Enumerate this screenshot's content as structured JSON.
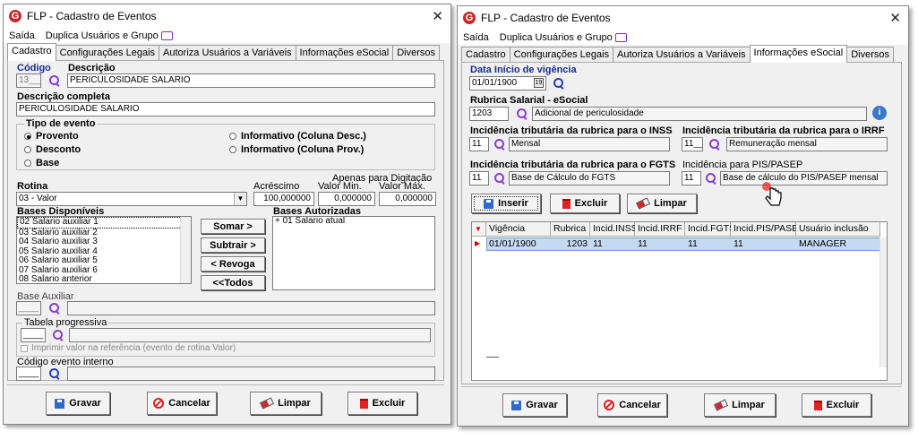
{
  "left": {
    "title": "FLP - Cadastro de Eventos",
    "menu": [
      "Saída",
      "Duplica Usuários e Grupo"
    ],
    "tabs": [
      "Cadastro",
      "Configurações Legais",
      "Autoriza Usuários a Variáveis",
      "Informações eSocial",
      "Diversos"
    ],
    "codigo_label": "Código",
    "codigo_value": "13___",
    "descricao_label": "Descrição",
    "descricao_value": "PERICULOSIDADE SALARIO",
    "desc_completa_label": "Descrição completa",
    "desc_completa_value": "PERICULOSIDADE SALARIO",
    "tipo_label": "Tipo de evento",
    "radios": [
      "Provento",
      "Desconto",
      "Base",
      "Informativo (Coluna Desc.)",
      "Informativo (Coluna Prov.)"
    ],
    "rotina_label": "Rotina",
    "rotina_value": "03 - Valor",
    "acrescimo_label": "Acréscimo",
    "acrescimo_value": "100,000000",
    "digitacao_label": "Apenas para Digitação",
    "valmin_label": "Valor Min.",
    "valmin_value": "0,000000",
    "valmax_label": "Valor Máx.",
    "valmax_value": "0,000000",
    "bases_disp_label": "Bases Disponíveis",
    "bases_disp": [
      "02 Salario auxiliar 1",
      "03 Salario auxiliar 2",
      "04 Salario auxiliar 3",
      "05 Salario auxiliar 4",
      "06 Salario auxiliar 5",
      "07 Salario auxiliar 6",
      "08 Salario anterior"
    ],
    "bases_aut_label": "Bases Autorizadas",
    "bases_aut": [
      "+ 01 Salario atual"
    ],
    "btn_somar": "Somar >",
    "btn_subtrair": "Subtrair >",
    "btn_revoga": "< Revoga",
    "btn_todos": "<<Todos",
    "base_aux_label": "Base Auxiliar",
    "base_aux_value": "____",
    "tabela_label": "Tabela progressiva",
    "tabela_value": "____",
    "imprimir_label": "Imprimir valor na referência (evento de rotina Valor)",
    "cod_interno_label": "Código evento interno",
    "cod_interno_value": "____",
    "buttons": [
      "Gravar",
      "Cancelar",
      "Limpar",
      "Excluir"
    ]
  },
  "right": {
    "title": "FLP - Cadastro de Eventos",
    "menu": [
      "Saída",
      "Duplica Usuários e Grupo"
    ],
    "tabs": [
      "Cadastro",
      "Configurações Legais",
      "Autoriza Usuários a Variáveis",
      "Informações eSocial",
      "Diversos"
    ],
    "data_label": "Data Início de vigência",
    "data_value": "01/01/1900",
    "rubrica_label": "Rubrica Salarial - eSocial",
    "rubrica_code": "1203",
    "rubrica_desc": "Adicional de periculosidade",
    "inss_label": "Incidência tributária da rubrica para o INSS",
    "inss_code": "11",
    "inss_desc": "Mensal",
    "irrf_label": "Incidência tributária da rubrica para o IRRF",
    "irrf_code": "11__",
    "irrf_desc": "Remuneração mensal",
    "fgts_label": "Incidência tributária da rubrica para o FGTS",
    "fgts_code": "11",
    "fgts_desc": "Base de Cálculo do FGTS",
    "pis_label": "Incidência para PIS/PASEP",
    "pis_code": "11",
    "pis_desc": "Base de cálculo do PIS/PASEP mensal",
    "btn_inserir": "Inserir",
    "btn_excluir": "Excluir",
    "btn_limpar": "Limpar",
    "grid_headers": [
      "Vigência",
      "Rubrica",
      "Incid.INSS",
      "Incid.IRRF",
      "Incid.FGTS",
      "Incid.PIS/PASEP",
      "Usuário inclusão"
    ],
    "grid_row": [
      "01/01/1900",
      "1203",
      "11",
      "11",
      "11",
      "11",
      "MANAGER"
    ],
    "buttons": [
      "Gravar",
      "Cancelar",
      "Limpar",
      "Excluir"
    ]
  },
  "colors": {
    "accent": "#8a3fd1",
    "selection": "#c5d9f1",
    "brand": "#c62828"
  }
}
